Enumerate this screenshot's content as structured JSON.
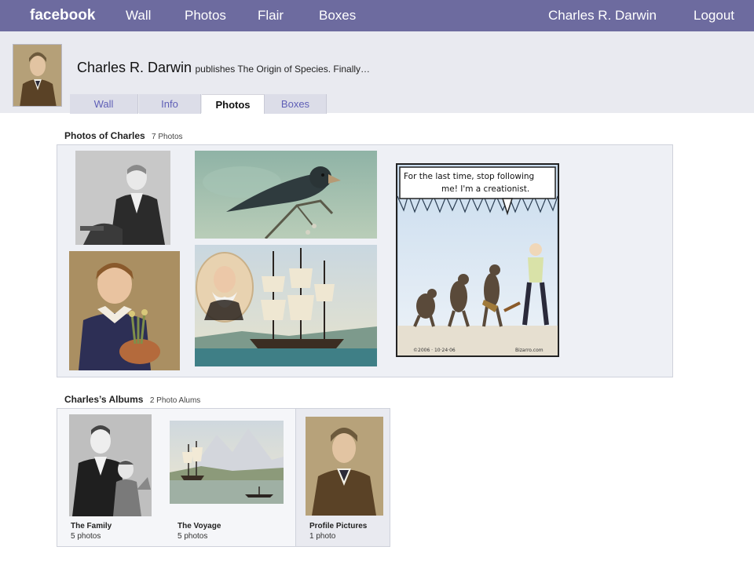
{
  "topnav": {
    "logo": "facebook",
    "wall": "Wall",
    "photos": "Photos",
    "flair": "Flair",
    "boxes": "Boxes",
    "user": "Charles R. Darwin",
    "logout": "Logout"
  },
  "profile": {
    "name": "Charles R. Darwin",
    "status": "publishes The Origin of Species. Finally…"
  },
  "tabs": [
    {
      "label": "Wall"
    },
    {
      "label": "Info"
    },
    {
      "label": "Photos"
    },
    {
      "label": "Boxes"
    }
  ],
  "photos_section": {
    "title": "Photos of Charles",
    "count": "7 Photos"
  },
  "cartoon": {
    "speech_line1": "For the last time, stop following",
    "speech_line2": "me!  I'm a creationist."
  },
  "albums_section": {
    "title": "Charles’s Albums",
    "count": "2 Photo Alums"
  },
  "albums": [
    {
      "name": "The Family",
      "count": "5 photos"
    },
    {
      "name": "The Voyage",
      "count": "5 photos"
    },
    {
      "name": "Profile Pictures",
      "count": "1 photo"
    }
  ],
  "colors": {
    "topbar": "#6d6b9f",
    "header_bg": "#e9eaf0",
    "tab_link": "#5f5fb6"
  }
}
